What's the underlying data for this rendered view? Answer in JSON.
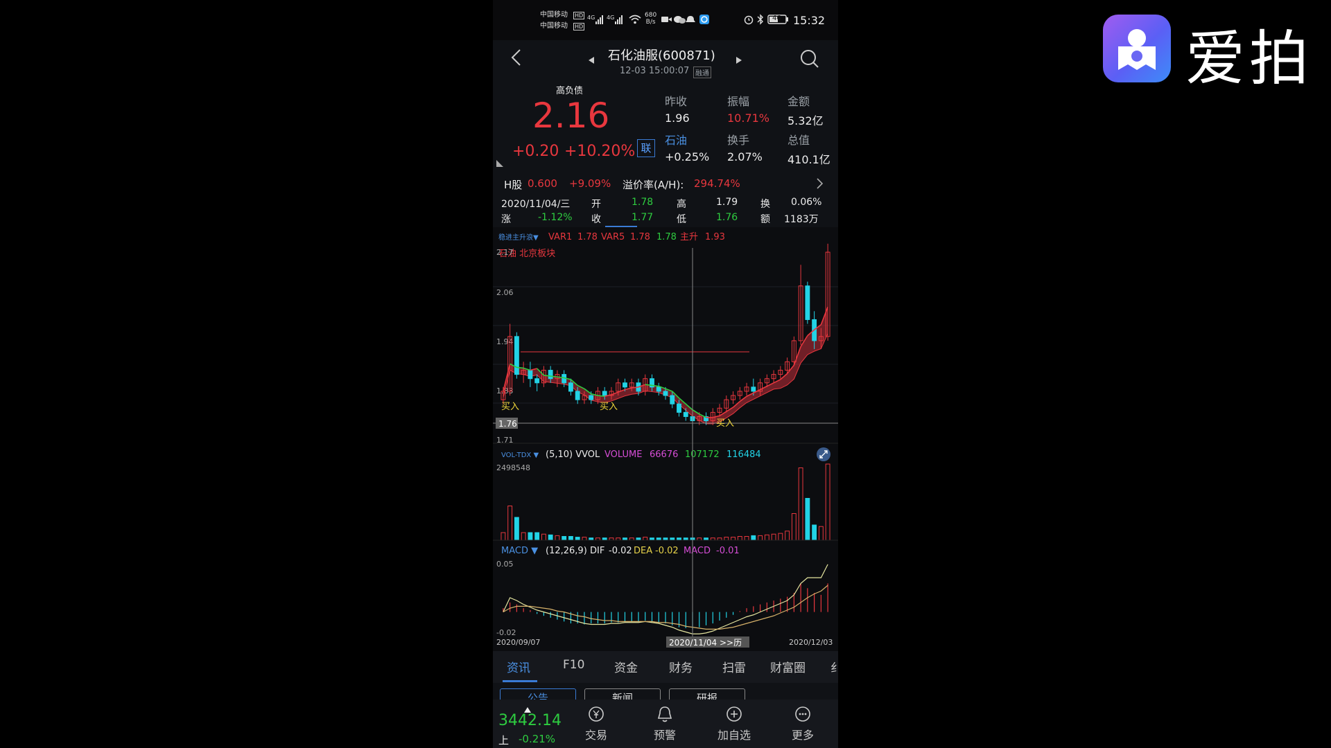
{
  "brand": {
    "name": "爱拍",
    "logo_icon": "aipai-logo-icon"
  },
  "status_bar": {
    "carrier1": "中国移动",
    "carrier2": "中国移动",
    "hd": "HD",
    "net": "4G",
    "speed": "680",
    "speed_unit": "B/s",
    "battery": "46",
    "time": "15:32"
  },
  "header": {
    "title": "石化油服(600871)",
    "datetime": "12-03 15:00:07",
    "badge": "融通"
  },
  "quote": {
    "tag": "高负债",
    "price": "2.16",
    "change": "+0.20",
    "change_pct": "+10.20%",
    "link_label": "联",
    "stats": [
      {
        "label": "昨收",
        "value": "1.96"
      },
      {
        "label": "振幅",
        "value": "10.71%"
      },
      {
        "label": "金额",
        "value": "5.32亿"
      },
      {
        "label": "石油",
        "value": "+0.25%"
      },
      {
        "label": "换手",
        "value": "2.07%"
      },
      {
        "label": "总值",
        "value": "410.1亿"
      }
    ],
    "hshare_label": "H股",
    "hshare_price": "0.600",
    "hshare_pct": "+9.09%",
    "premium_label": "溢价率(A/H):",
    "premium_value": "294.74%"
  },
  "day_info": {
    "date": "2020/11/04/三",
    "zhang_label": "涨",
    "zhang": "-1.12%",
    "kai_label": "开",
    "kai": "1.78",
    "shou_label": "收",
    "shou": "1.77",
    "gao_label": "高",
    "gao": "1.79",
    "di_label": "低",
    "di": "1.76",
    "huan_label": "换",
    "huan": "0.06%",
    "e_label": "额",
    "e": "1183万"
  },
  "kline": {
    "indicator_name": "稳进主升浪▼",
    "var1_label": "VAR1",
    "var1": "1.78",
    "var5_label": "VAR5",
    "var5": "1.78",
    "v3": "1.78",
    "zhusheng_label": "主升",
    "zhusheng": "1.93",
    "sector": "石油 北京板块",
    "y_ticks": [
      "2.17",
      "2.06",
      "1.94",
      "1.83",
      "1.71"
    ],
    "cursor_price": "1.76",
    "buy_label": "买入"
  },
  "volume": {
    "name": "VOL-TDX ▼",
    "params": "(5,10) VVOL",
    "vol_label": "VOLUME",
    "v1": "66676",
    "v2": "107172",
    "v3": "116484",
    "max": "2498548",
    "expand_icon": "expand-icon"
  },
  "macd": {
    "name": "MACD ▼",
    "params": "(12,26,9)",
    "dif_label": "DIF",
    "dif": "-0.02",
    "dea_label": "DEA",
    "dea": "-0.02",
    "macd_label": "MACD",
    "macd": "-0.01",
    "top": "0.05",
    "bottom": "-0.02"
  },
  "date_axis": {
    "start": "2020/09/07",
    "cursor": "2020/11/04 >>历",
    "end": "2020/12/03"
  },
  "tabs": [
    "资讯",
    "F10",
    "资金",
    "财务",
    "扫雷",
    "财富圈",
    "纟"
  ],
  "sub_tabs": [
    "公告",
    "新闻",
    "研报"
  ],
  "bottom_bar": {
    "index_value": "3442.14",
    "index_name": "上",
    "index_pct": "-0.21%",
    "buttons": [
      {
        "label": "交易",
        "icon": "yuan-icon"
      },
      {
        "label": "预警",
        "icon": "bell-icon"
      },
      {
        "label": "加自选",
        "icon": "plus-circle-icon"
      },
      {
        "label": "更多",
        "icon": "more-icon"
      }
    ]
  },
  "colors": {
    "up": "#e8373e",
    "down": "#22d3e6",
    "ma_green": "#2ecc40",
    "dif": "#e6e6a0",
    "dea": "#d7b26a"
  },
  "chart_data": {
    "type": "candlestick",
    "price_range": [
      1.71,
      2.17
    ],
    "candles": [
      [
        1.81,
        1.84,
        1.8,
        1.83
      ],
      [
        1.83,
        1.99,
        1.82,
        1.96
      ],
      [
        1.96,
        1.97,
        1.86,
        1.87
      ],
      [
        1.87,
        1.9,
        1.85,
        1.88
      ],
      [
        1.88,
        1.9,
        1.84,
        1.86
      ],
      [
        1.86,
        1.87,
        1.83,
        1.85
      ],
      [
        1.85,
        1.89,
        1.84,
        1.88
      ],
      [
        1.88,
        1.89,
        1.85,
        1.86
      ],
      [
        1.86,
        1.88,
        1.84,
        1.87
      ],
      [
        1.87,
        1.88,
        1.84,
        1.85
      ],
      [
        1.85,
        1.86,
        1.82,
        1.83
      ],
      [
        1.83,
        1.84,
        1.8,
        1.81
      ],
      [
        1.81,
        1.83,
        1.8,
        1.82
      ],
      [
        1.82,
        1.83,
        1.8,
        1.81
      ],
      [
        1.81,
        1.84,
        1.8,
        1.83
      ],
      [
        1.83,
        1.84,
        1.81,
        1.82
      ],
      [
        1.82,
        1.84,
        1.81,
        1.83
      ],
      [
        1.83,
        1.86,
        1.82,
        1.85
      ],
      [
        1.85,
        1.86,
        1.83,
        1.84
      ],
      [
        1.84,
        1.86,
        1.83,
        1.85
      ],
      [
        1.85,
        1.86,
        1.82,
        1.83
      ],
      [
        1.83,
        1.87,
        1.82,
        1.86
      ],
      [
        1.86,
        1.87,
        1.83,
        1.84
      ],
      [
        1.84,
        1.85,
        1.82,
        1.83
      ],
      [
        1.83,
        1.84,
        1.81,
        1.82
      ],
      [
        1.82,
        1.83,
        1.79,
        1.8
      ],
      [
        1.8,
        1.81,
        1.77,
        1.78
      ],
      [
        1.78,
        1.79,
        1.76,
        1.77
      ],
      [
        1.77,
        1.78,
        1.74,
        1.76
      ],
      [
        1.76,
        1.78,
        1.75,
        1.77
      ],
      [
        1.77,
        1.78,
        1.75,
        1.76
      ],
      [
        1.76,
        1.79,
        1.75,
        1.78
      ],
      [
        1.78,
        1.8,
        1.77,
        1.79
      ],
      [
        1.79,
        1.82,
        1.78,
        1.81
      ],
      [
        1.81,
        1.83,
        1.8,
        1.82
      ],
      [
        1.82,
        1.84,
        1.81,
        1.83
      ],
      [
        1.83,
        1.85,
        1.82,
        1.84
      ],
      [
        1.84,
        1.86,
        1.82,
        1.83
      ],
      [
        1.83,
        1.86,
        1.82,
        1.85
      ],
      [
        1.85,
        1.87,
        1.84,
        1.86
      ],
      [
        1.86,
        1.88,
        1.85,
        1.87
      ],
      [
        1.87,
        1.89,
        1.86,
        1.88
      ],
      [
        1.88,
        1.91,
        1.87,
        1.9
      ],
      [
        1.9,
        1.96,
        1.89,
        1.95
      ],
      [
        1.95,
        2.13,
        1.94,
        2.08
      ],
      [
        2.08,
        2.09,
        1.99,
        2.0
      ],
      [
        2.0,
        2.02,
        1.93,
        1.95
      ],
      [
        1.95,
        1.98,
        1.93,
        1.96
      ],
      [
        1.96,
        2.18,
        1.95,
        2.16
      ]
    ],
    "volume": [
      0.1,
      0.45,
      0.3,
      0.1,
      0.1,
      0.1,
      0.08,
      0.07,
      0.06,
      0.05,
      0.05,
      0.04,
      0.04,
      0.03,
      0.03,
      0.03,
      0.03,
      0.03,
      0.03,
      0.03,
      0.03,
      0.04,
      0.03,
      0.03,
      0.03,
      0.03,
      0.03,
      0.03,
      0.03,
      0.03,
      0.03,
      0.03,
      0.03,
      0.04,
      0.04,
      0.05,
      0.05,
      0.06,
      0.06,
      0.07,
      0.08,
      0.09,
      0.12,
      0.35,
      0.95,
      0.55,
      0.2,
      0.18,
      1.0
    ],
    "macd_hist": [
      0.004,
      0.01,
      0.008,
      0.004,
      0.002,
      -0.002,
      -0.004,
      -0.006,
      -0.008,
      -0.01,
      -0.012,
      -0.012,
      -0.013,
      -0.012,
      -0.012,
      -0.012,
      -0.011,
      -0.011,
      -0.01,
      -0.01,
      -0.01,
      -0.009,
      -0.01,
      -0.011,
      -0.012,
      -0.014,
      -0.016,
      -0.017,
      -0.018,
      -0.016,
      -0.014,
      -0.012,
      -0.009,
      -0.006,
      -0.003,
      0.001,
      0.004,
      0.006,
      0.008,
      0.01,
      0.012,
      0.014,
      0.016,
      0.02,
      0.03,
      0.025,
      0.02,
      0.018,
      0.03
    ],
    "dif": [
      0.0,
      0.015,
      0.012,
      0.008,
      0.005,
      0.002,
      0.0,
      -0.002,
      -0.004,
      -0.006,
      -0.008,
      -0.01,
      -0.012,
      -0.013,
      -0.013,
      -0.013,
      -0.012,
      -0.012,
      -0.011,
      -0.011,
      -0.011,
      -0.01,
      -0.011,
      -0.012,
      -0.014,
      -0.016,
      -0.019,
      -0.021,
      -0.023,
      -0.023,
      -0.022,
      -0.02,
      -0.017,
      -0.014,
      -0.011,
      -0.008,
      -0.005,
      -0.003,
      0.0,
      0.003,
      0.006,
      0.009,
      0.012,
      0.018,
      0.03,
      0.036,
      0.036,
      0.036,
      0.05
    ],
    "dea": [
      0.0,
      0.004,
      0.006,
      0.006,
      0.006,
      0.005,
      0.004,
      0.003,
      0.001,
      0.0,
      -0.002,
      -0.004,
      -0.005,
      -0.007,
      -0.008,
      -0.009,
      -0.009,
      -0.01,
      -0.01,
      -0.01,
      -0.01,
      -0.01,
      -0.01,
      -0.011,
      -0.011,
      -0.012,
      -0.013,
      -0.015,
      -0.016,
      -0.017,
      -0.018,
      -0.018,
      -0.018,
      -0.017,
      -0.016,
      -0.014,
      -0.012,
      -0.01,
      -0.008,
      -0.006,
      -0.004,
      -0.001,
      0.002,
      0.005,
      0.01,
      0.015,
      0.019,
      0.022,
      0.028
    ],
    "cursor_index": 28
  }
}
